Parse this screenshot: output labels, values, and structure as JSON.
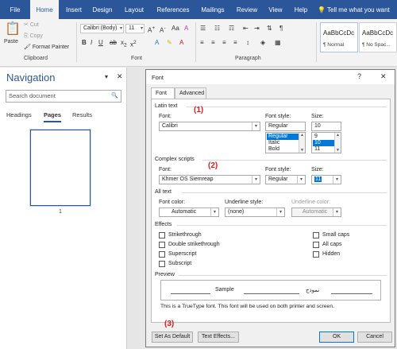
{
  "ribbon": {
    "tabs": [
      "File",
      "Home",
      "Insert",
      "Design",
      "Layout",
      "References",
      "Mailings",
      "Review",
      "View",
      "Help"
    ],
    "active_tab": "Home",
    "tell_me": "Tell me what you want",
    "clipboard": {
      "paste": "Paste",
      "cut": "Cut",
      "copy": "Copy",
      "format_painter": "Format Painter",
      "label": "Clipboard"
    },
    "font": {
      "name": "Calibri (Body)",
      "size": "11",
      "label": "Font"
    },
    "paragraph": {
      "label": "Paragraph"
    },
    "styles": [
      {
        "preview": "AaBbCcDc",
        "name": "¶ Normal"
      },
      {
        "preview": "AaBbCcDc",
        "name": "¶ No Spac..."
      }
    ]
  },
  "navigation": {
    "title": "Navigation",
    "search_placeholder": "Search document",
    "tabs": [
      "Headings",
      "Pages",
      "Results"
    ],
    "active_tab": "Pages",
    "page_number": "1"
  },
  "dialog": {
    "title": "Font",
    "help": "?",
    "close": "✕",
    "tabs": [
      "Font",
      "Advanced"
    ],
    "active_tab": "Font",
    "latin": {
      "section": "Latin text",
      "font_label": "Font:",
      "font_value": "Calibri",
      "style_label": "Font style:",
      "style_value": "Regular",
      "style_options": [
        "Regular",
        "Italic",
        "Bold"
      ],
      "style_selected": "Regular",
      "size_label": "Size:",
      "size_value": "10",
      "size_options": [
        "9",
        "10",
        "11"
      ],
      "size_selected": "10"
    },
    "complex": {
      "section": "Complex scripts",
      "font_label": "Font:",
      "font_value": "Khmer OS Siemreap",
      "style_label": "Font style:",
      "style_value": "Regular",
      "size_label": "Size:",
      "size_value": "11"
    },
    "all_text": {
      "section": "All text",
      "color_label": "Font color:",
      "color_value": "Automatic",
      "underline_label": "Underline style:",
      "underline_value": "(none)",
      "underline_color_label": "Underline color:",
      "underline_color_value": "Automatic"
    },
    "effects": {
      "section": "Effects",
      "left": [
        "Strikethrough",
        "Double strikethrough",
        "Superscript",
        "Subscript"
      ],
      "right": [
        "Small caps",
        "All caps",
        "Hidden"
      ]
    },
    "preview": {
      "section": "Preview",
      "sample": "Sample",
      "complex_sample": "نموذج",
      "note": "This is a TrueType font. This font will be used on both printer and screen."
    },
    "buttons": {
      "set_default": "Set As Default",
      "text_effects": "Text Effects...",
      "ok": "OK",
      "cancel": "Cancel"
    }
  },
  "annotations": [
    "(1)",
    "(2)",
    "(3)"
  ],
  "colors": {
    "brand": "#2b579a",
    "annotation": "#d81e1e",
    "selection": "#0078d7"
  }
}
